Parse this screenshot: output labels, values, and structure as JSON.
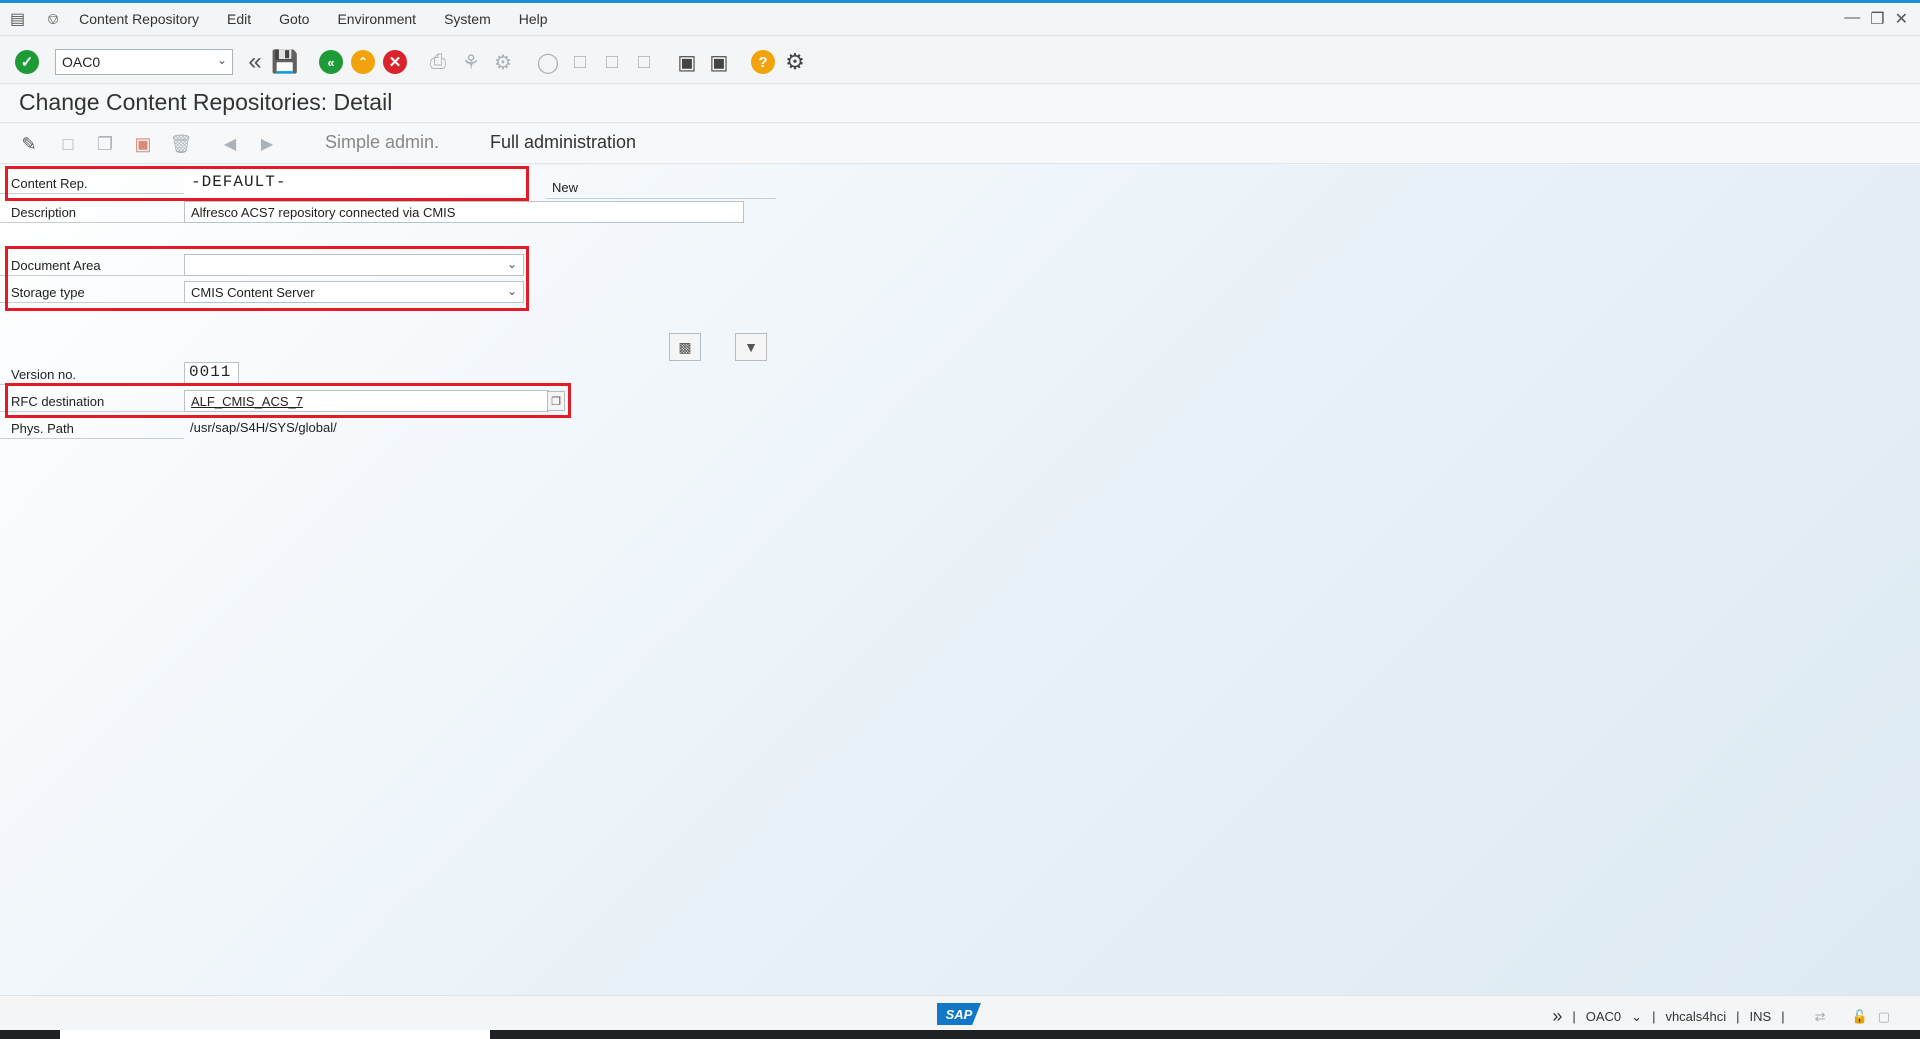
{
  "menu": {
    "items": [
      "Content Repository",
      "Edit",
      "Goto",
      "Environment",
      "System",
      "Help"
    ]
  },
  "toolbar": {
    "tcode_value": "OAC0"
  },
  "title": "Change Content Repositories: Detail",
  "app_toolbar": {
    "simple_admin": "Simple admin.",
    "full_admin": "Full administration"
  },
  "form": {
    "content_rep_label": "Content Rep.",
    "content_rep_value": "-DEFAULT-",
    "new_label": "New",
    "description_label": "Description",
    "description_value": "Alfresco ACS7 repository connected via CMIS",
    "document_area_label": "Document Area",
    "document_area_value": "",
    "storage_type_label": "Storage type",
    "storage_type_value": "CMIS Content Server",
    "version_label": "Version no.",
    "version_value": "0011",
    "rfc_label": "RFC destination",
    "rfc_value": "ALF_CMIS_ACS_7",
    "phys_path_label": "Phys. Path",
    "phys_path_value": "/usr/sap/S4H/SYS/global/"
  },
  "statusbar": {
    "logo": "SAP",
    "tcode": "OAC0",
    "host": "vhcals4hci",
    "mode": "INS"
  },
  "colors": {
    "accent": "#1a8fd8",
    "highlight": "#e21b24",
    "ok_green": "#1e9a36"
  }
}
